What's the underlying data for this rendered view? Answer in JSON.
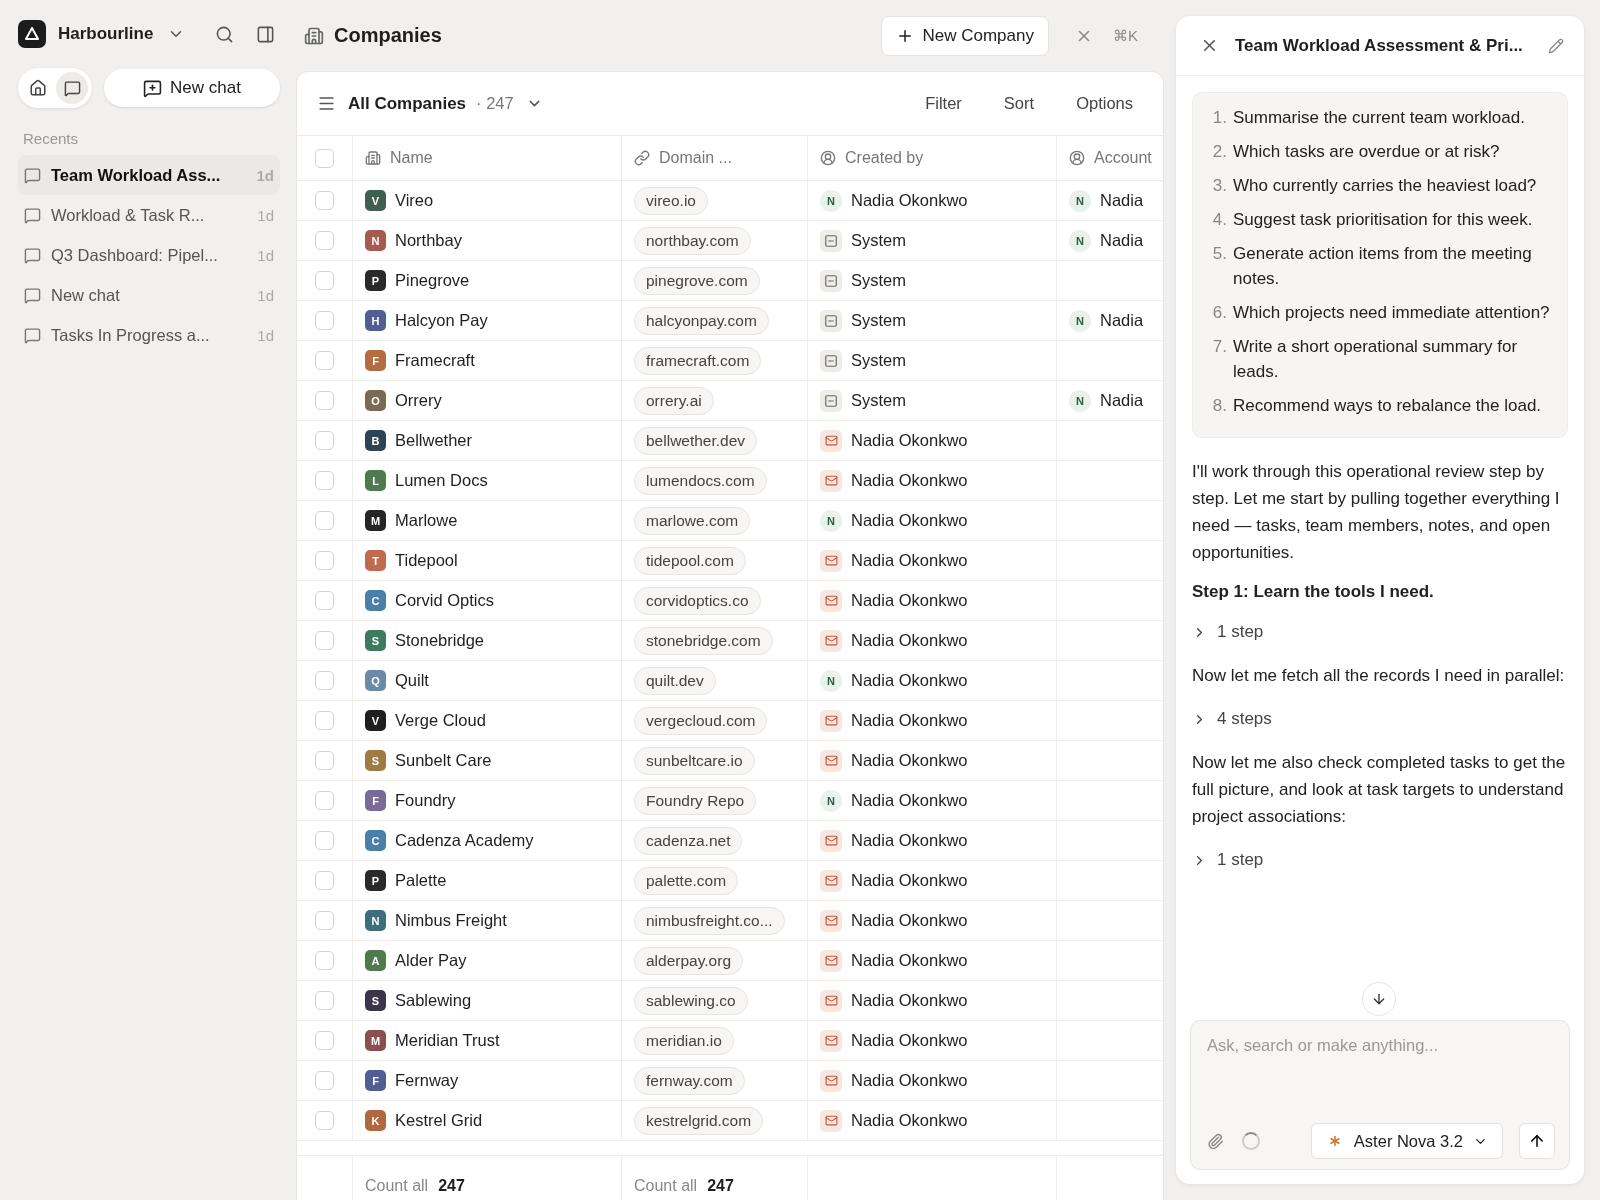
{
  "workspace": {
    "name": "Harbourline"
  },
  "sidebar": {
    "view_toggle": [
      {
        "selected": false
      },
      {
        "selected": true
      }
    ],
    "new_chat": "New chat",
    "recents_label": "Recents",
    "recents": [
      {
        "title": "Team Workload Ass...",
        "age": "1d",
        "selected": true
      },
      {
        "title": "Workload & Task R...",
        "age": "1d",
        "selected": false
      },
      {
        "title": "Q3 Dashboard: Pipel...",
        "age": "1d",
        "selected": false
      },
      {
        "title": "New chat",
        "age": "1d",
        "selected": false
      },
      {
        "title": "Tasks In Progress a...",
        "age": "1d",
        "selected": false
      }
    ]
  },
  "page": {
    "title": "Companies",
    "new_button": "New Company",
    "shortcut": "⌘K"
  },
  "view": {
    "name": "All Companies",
    "count": "· 247",
    "actions": [
      "Filter",
      "Sort",
      "Options"
    ]
  },
  "table": {
    "columns": [
      "Name",
      "Domain ...",
      "Created by",
      "Account"
    ],
    "all_selected": false,
    "rows": [
      {
        "name": "Vireo",
        "initial": "V",
        "color": "#3e5f52",
        "domain": "vireo.io",
        "creator": {
          "kind": "person",
          "initial": "N",
          "name": "Nadia Okonkwo"
        },
        "account_initial": "N",
        "account": "Nadia",
        "selected": false
      },
      {
        "name": "Northbay",
        "initial": "N",
        "color": "#a65a50",
        "domain": "northbay.com",
        "creator": {
          "kind": "system",
          "name": "System"
        },
        "account_initial": "N",
        "account": "Nadia",
        "selected": false
      },
      {
        "name": "Pinegrove",
        "initial": "P",
        "color": "#2a2a2a",
        "domain": "pinegrove.com",
        "creator": {
          "kind": "system",
          "name": "System"
        },
        "selected": false
      },
      {
        "name": "Halcyon Pay",
        "initial": "H",
        "color": "#505e93",
        "domain": "halcyonpay.com",
        "creator": {
          "kind": "system",
          "name": "System"
        },
        "account_initial": "N",
        "account": "Nadia",
        "selected": false
      },
      {
        "name": "Framecraft",
        "initial": "F",
        "color": "#b26d42",
        "domain": "framecraft.com",
        "creator": {
          "kind": "system",
          "name": "System"
        },
        "selected": false
      },
      {
        "name": "Orrery",
        "initial": "O",
        "color": "#7a6a55",
        "domain": "orrery.ai",
        "creator": {
          "kind": "system",
          "name": "System"
        },
        "account_initial": "N",
        "account": "Nadia",
        "selected": false
      },
      {
        "name": "Bellwether",
        "initial": "B",
        "color": "#2f4452",
        "domain": "bellwether.dev",
        "creator": {
          "kind": "email",
          "name": "Nadia Okonkwo"
        },
        "selected": false
      },
      {
        "name": "Lumen Docs",
        "initial": "L",
        "color": "#4f7a4f",
        "domain": "lumendocs.com",
        "creator": {
          "kind": "email",
          "name": "Nadia Okonkwo"
        },
        "selected": false
      },
      {
        "name": "Marlowe",
        "initial": "M",
        "color": "#262626",
        "domain": "marlowe.com",
        "creator": {
          "kind": "person",
          "initial": "N",
          "name": "Nadia Okonkwo"
        },
        "selected": false
      },
      {
        "name": "Tidepool",
        "initial": "T",
        "color": "#c06a50",
        "domain": "tidepool.com",
        "creator": {
          "kind": "email",
          "name": "Nadia Okonkwo"
        },
        "selected": false
      },
      {
        "name": "Corvid Optics",
        "initial": "C",
        "color": "#4a80a8",
        "domain": "corvidoptics.co",
        "creator": {
          "kind": "email",
          "name": "Nadia Okonkwo"
        },
        "selected": false
      },
      {
        "name": "Stonebridge",
        "initial": "S",
        "color": "#3e7a5e",
        "domain": "stonebridge.com",
        "creator": {
          "kind": "email",
          "name": "Nadia Okonkwo"
        },
        "selected": false
      },
      {
        "name": "Quilt",
        "initial": "Q",
        "color": "#6a8aa8",
        "domain": "quilt.dev",
        "creator": {
          "kind": "person",
          "initial": "N",
          "name": "Nadia Okonkwo"
        },
        "selected": false
      },
      {
        "name": "Verge Cloud",
        "initial": "V",
        "color": "#1f1f1f",
        "domain": "vergecloud.com",
        "creator": {
          "kind": "email",
          "name": "Nadia Okonkwo"
        },
        "selected": false
      },
      {
        "name": "Sunbelt Care",
        "initial": "S",
        "color": "#a07a45",
        "domain": "sunbeltcare.io",
        "creator": {
          "kind": "email",
          "name": "Nadia Okonkwo"
        },
        "selected": false
      },
      {
        "name": "Foundry",
        "initial": "F",
        "color": "#7a6a9a",
        "domain": "Foundry Repo",
        "creator": {
          "kind": "person",
          "initial": "N",
          "name": "Nadia Okonkwo"
        },
        "selected": false
      },
      {
        "name": "Cadenza Academy",
        "initial": "C",
        "color": "#4a7fa8",
        "domain": "cadenza.net",
        "creator": {
          "kind": "email",
          "name": "Nadia Okonkwo"
        },
        "selected": false
      },
      {
        "name": "Palette",
        "initial": "P",
        "color": "#2a2a2a",
        "domain": "palette.com",
        "creator": {
          "kind": "email",
          "name": "Nadia Okonkwo"
        },
        "selected": false
      },
      {
        "name": "Nimbus Freight",
        "initial": "N",
        "color": "#3d6e7a",
        "domain": "nimbusfreight.co...",
        "creator": {
          "kind": "email",
          "name": "Nadia Okonkwo"
        },
        "selected": false
      },
      {
        "name": "Alder Pay",
        "initial": "A",
        "color": "#4e7a4e",
        "domain": "alderpay.org",
        "creator": {
          "kind": "email",
          "name": "Nadia Okonkwo"
        },
        "selected": false
      },
      {
        "name": "Sablewing",
        "initial": "S",
        "color": "#3a3548",
        "domain": "sablewing.co",
        "creator": {
          "kind": "email",
          "name": "Nadia Okonkwo"
        },
        "selected": false
      },
      {
        "name": "Meridian Trust",
        "initial": "M",
        "color": "#8a4f4f",
        "domain": "meridian.io",
        "creator": {
          "kind": "email",
          "name": "Nadia Okonkwo"
        },
        "selected": false
      },
      {
        "name": "Fernway",
        "initial": "F",
        "color": "#4f5f94",
        "domain": "fernway.com",
        "creator": {
          "kind": "email",
          "name": "Nadia Okonkwo"
        },
        "selected": false
      },
      {
        "name": "Kestrel Grid",
        "initial": "K",
        "color": "#b0683f",
        "domain": "kestrelgrid.com",
        "creator": {
          "kind": "email",
          "name": "Nadia Okonkwo"
        },
        "selected": false
      }
    ],
    "footer": [
      {
        "label": "Count all",
        "value": "247"
      },
      {
        "label": "Count all",
        "value": "247"
      }
    ]
  },
  "chat": {
    "title": "Team Workload Assessment & Pri...",
    "prompt": [
      {
        "num": "1.",
        "text": "Summarise the current team workload."
      },
      {
        "num": "2.",
        "text": "Which tasks are overdue or at risk?"
      },
      {
        "num": "3.",
        "text": "Who currently carries the heaviest load?"
      },
      {
        "num": "4.",
        "text": "Suggest task prioritisation for this week."
      },
      {
        "num": "5.",
        "text": "Generate action items from the meeting notes."
      },
      {
        "num": "6.",
        "text": "Which projects need immediate attention?"
      },
      {
        "num": "7.",
        "text": "Write a short operational summary for leads."
      },
      {
        "num": "8.",
        "text": "Recommend ways to rebalance the load."
      }
    ],
    "messages": [
      {
        "kind": "paragraph",
        "text": "I'll work through this operational review step by step. Let me start by pulling together everything I need — tasks, team members, notes, and open opportunities."
      },
      {
        "kind": "heading",
        "text": "Step 1: Learn the tools I need."
      },
      {
        "kind": "steps",
        "text": "1 step",
        "expanded": false
      },
      {
        "kind": "paragraph",
        "text": "Now let me fetch all the records I need in parallel:"
      },
      {
        "kind": "steps",
        "text": "4 steps",
        "expanded": false
      },
      {
        "kind": "paragraph",
        "text": "Now let me also check completed tasks to get the full picture, and look at task targets to understand project associations:"
      },
      {
        "kind": "steps",
        "text": "1 step",
        "expanded": false
      }
    ],
    "composer": {
      "placeholder": "Ask, search or make anything...",
      "model": "Aster Nova 3.2"
    }
  }
}
